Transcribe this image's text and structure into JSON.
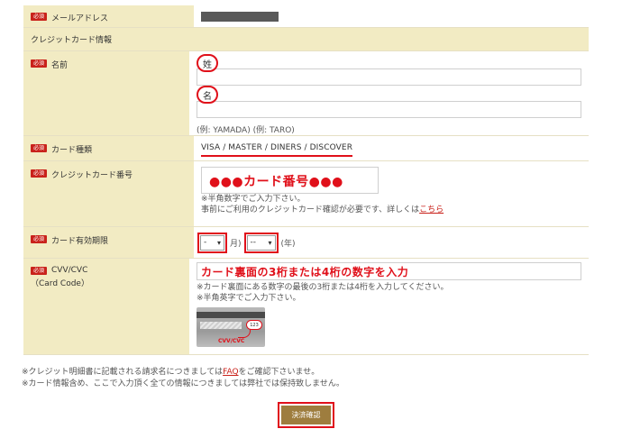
{
  "required_badge": "必須",
  "email": {
    "label": "メールアドレス"
  },
  "section": {
    "title": "クレジットカード情報"
  },
  "name": {
    "label": "名前",
    "last_label": "姓",
    "first_label": "名",
    "example": "(例: YAMADA) (例: TARO)"
  },
  "card_type": {
    "label": "カード種類",
    "types": "VISA / MASTER / DINERS / DISCOVER"
  },
  "card_number": {
    "label": "クレジットカード番号",
    "value": "●●●カード番号●●●",
    "note1": "※半角数字でご入力下さい。",
    "note2_prefix": "事前にご利用のクレジットカード確認が必要です、詳しくは",
    "note2_link": "こちら"
  },
  "expiry": {
    "label": "カード有効期限",
    "month_value": "-",
    "month_unit": "月)",
    "year_value": "--",
    "year_unit": "(年)"
  },
  "cvv": {
    "label": "CVV/CVC",
    "sublabel": "（Card Code）",
    "value": "カード裏面の3桁または4桁の数字を入力",
    "note1": "※カード裏面にある数字の最後の3桁または4桁を入力してください。",
    "note2": "※半角英字でご入力下さい。",
    "image_digits": "123",
    "image_caption": "CVV/CVC"
  },
  "footer": {
    "note1_prefix": "※クレジット明細書に記載される請求名につきましては",
    "note1_link": "FAQ",
    "note1_suffix": "をご確認下さいませ。",
    "note2": "※カード情報含め、ここで入力頂く全ての情報につきましては弊社では保持致しません。"
  },
  "submit": {
    "label": "決済確認"
  },
  "colors": {
    "accent_red": "#e0101a",
    "label_bg": "#f2ebc3",
    "button_bg": "#9e7d3e"
  }
}
